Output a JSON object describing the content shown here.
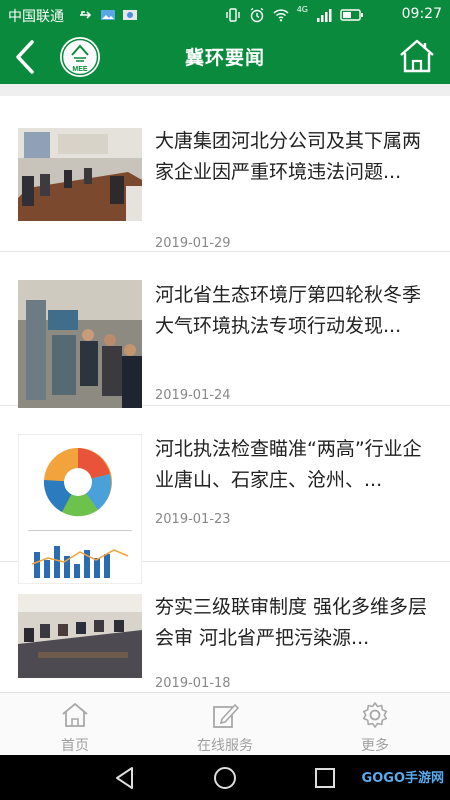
{
  "status_bar": {
    "carrier": "中国联通",
    "network": "4G",
    "time": "09:27"
  },
  "header": {
    "title": "冀环要闻",
    "logo_text": "MEE"
  },
  "news": [
    {
      "title": "大唐集团河北分公司及其下属两家企业因严重环境违法问题...",
      "date": "2019-01-29"
    },
    {
      "title": "河北省生态环境厅第四轮秋冬季大气环境执法专项行动发现...",
      "date": "2019-01-24"
    },
    {
      "title": "河北执法检查瞄准“两高”行业企业唐山、石家庄、沧州、...",
      "date": "2019-01-23"
    },
    {
      "title": "夯实三级联审制度 强化多维多层会审 河北省严把污染源...",
      "date": "2019-01-18"
    }
  ],
  "tabbar": [
    {
      "label": "首页",
      "icon": "home-icon"
    },
    {
      "label": "在线服务",
      "icon": "edit-icon"
    },
    {
      "label": "更多",
      "icon": "gear-icon"
    }
  ],
  "watermark": "GOGO手游网",
  "colors": {
    "brand_green": "#0a8a3c",
    "text": "#222222",
    "muted": "#888888"
  }
}
